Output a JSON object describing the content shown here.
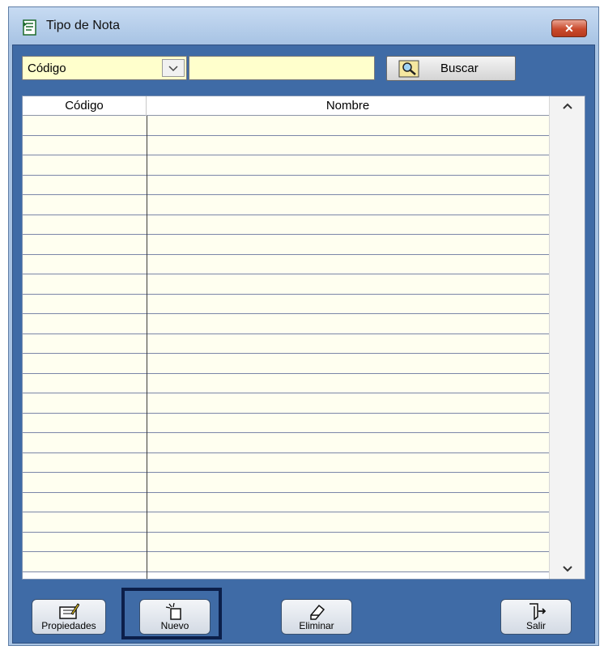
{
  "window": {
    "title": "Tipo de Nota",
    "close_label": "✕"
  },
  "search": {
    "field_selector_value": "Código",
    "search_value": "",
    "search_button_label": "Buscar"
  },
  "grid": {
    "columns": [
      "Código",
      "Nombre"
    ],
    "rows": []
  },
  "footer": {
    "buttons": [
      {
        "label": "Propiedades"
      },
      {
        "label": "Nuevo"
      },
      {
        "label": "Eliminar"
      },
      {
        "label": "Salir"
      }
    ],
    "focused_button": "Nuevo"
  },
  "colors": {
    "input_background": "#ffffcc",
    "client_background": "#3f6ba6",
    "close_button": "#c94a2c"
  }
}
